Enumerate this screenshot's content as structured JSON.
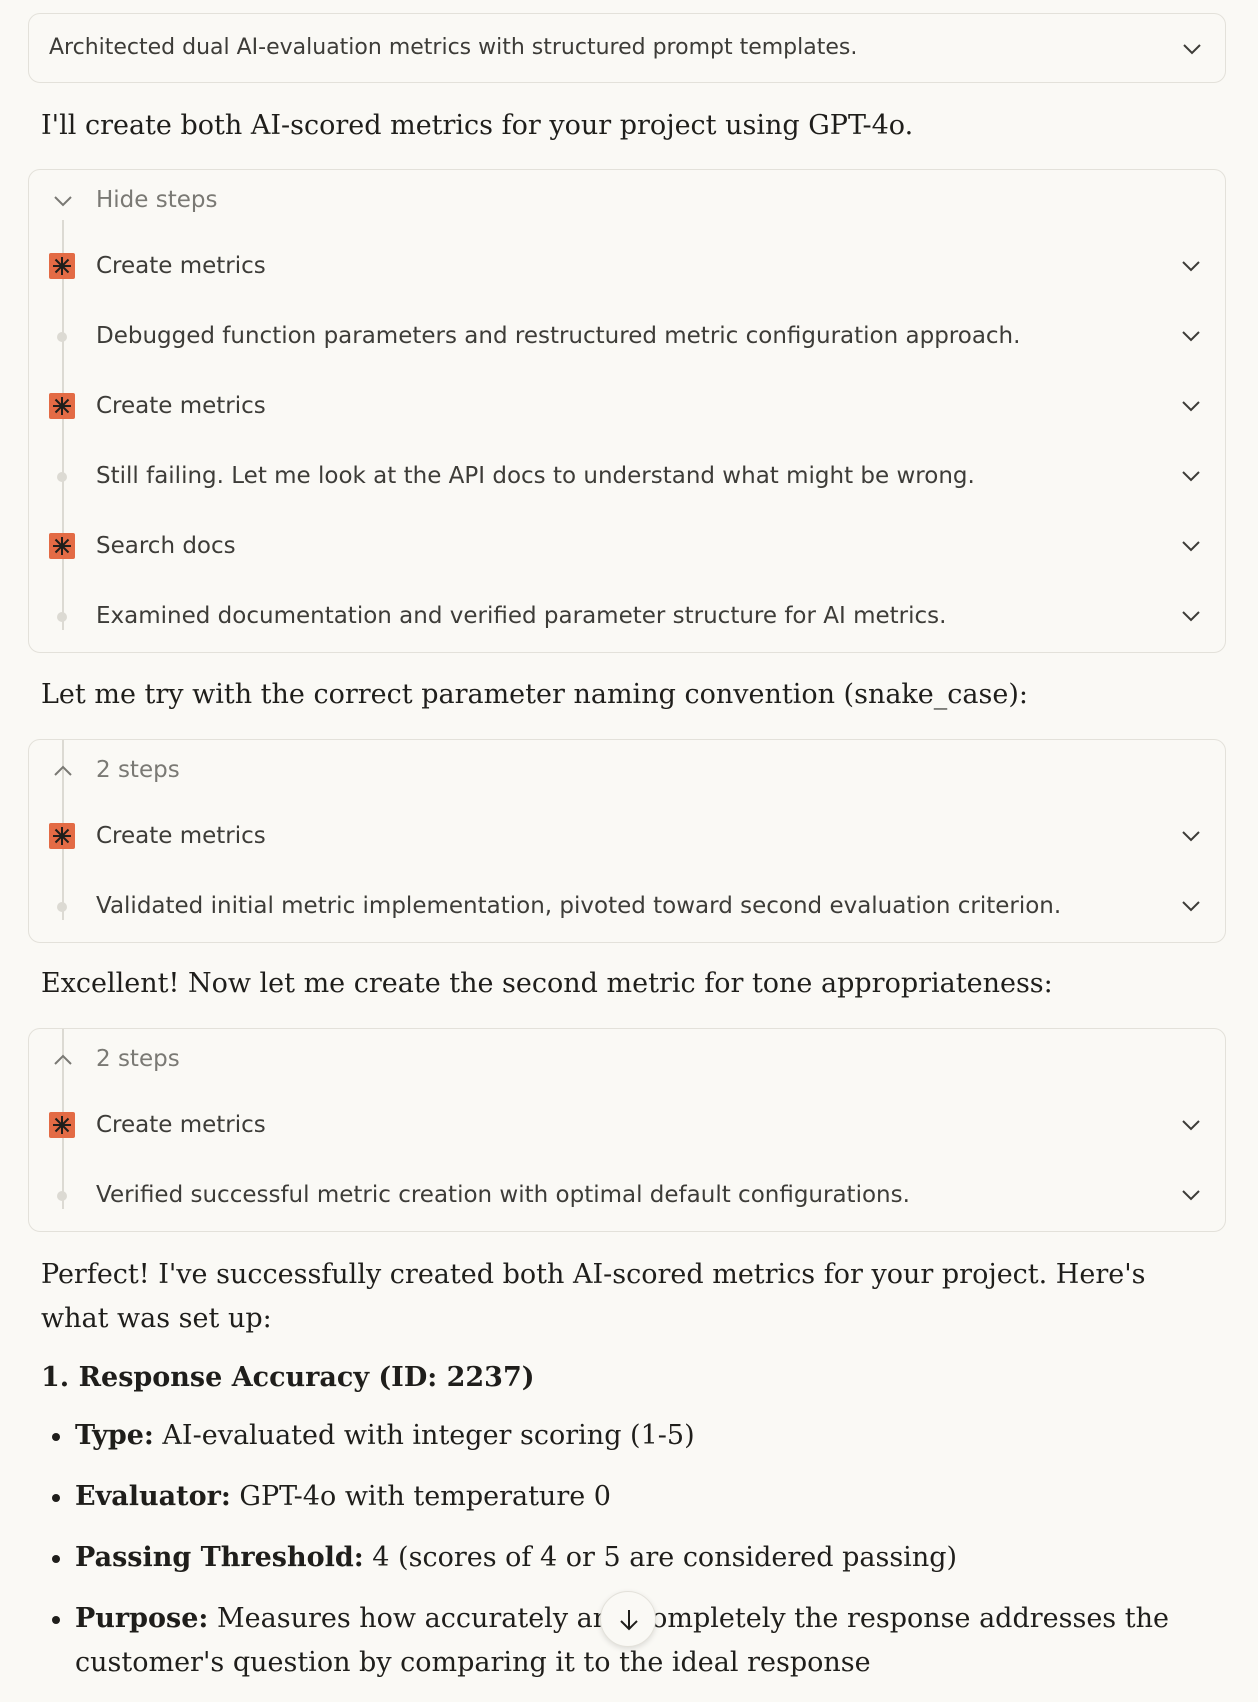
{
  "thought_summary": "Architected dual AI-evaluation metrics with structured prompt templates.",
  "intro": "I'll create both AI-scored metrics for your project using GPT-4o.",
  "panel1": {
    "toggle_label": "Hide steps",
    "steps": [
      {
        "kind": "tool",
        "label": "Create metrics"
      },
      {
        "kind": "thought",
        "label": "Debugged function parameters and restructured metric configuration approach."
      },
      {
        "kind": "tool",
        "label": "Create metrics"
      },
      {
        "kind": "thought",
        "label": "Still failing. Let me look at the API docs to understand what might be wrong."
      },
      {
        "kind": "tool",
        "label": "Search docs"
      },
      {
        "kind": "thought",
        "label": "Examined documentation and verified parameter structure for AI metrics."
      }
    ]
  },
  "msg2": "Let me try with the correct parameter naming convention (snake_case):",
  "panel2": {
    "toggle_label": "2 steps",
    "steps": [
      {
        "kind": "tool",
        "label": "Create metrics"
      },
      {
        "kind": "thought",
        "label": "Validated initial metric implementation, pivoted toward second evaluation criterion."
      }
    ]
  },
  "msg3": "Excellent! Now let me create the second metric for tone appropriateness:",
  "panel3": {
    "toggle_label": "2 steps",
    "steps": [
      {
        "kind": "tool",
        "label": "Create metrics"
      },
      {
        "kind": "thought",
        "label": "Verified successful metric creation with optimal default configurations."
      }
    ]
  },
  "summary_intro": "Perfect! I've successfully created both AI-scored metrics for your project. Here's what was set up:",
  "metric1": {
    "heading": "1. Response Accuracy (ID: 2237)",
    "items": [
      {
        "key": "Type:",
        "value": " AI-evaluated with integer scoring (1-5)"
      },
      {
        "key": "Evaluator:",
        "value": " GPT-4o with temperature 0"
      },
      {
        "key": "Passing Threshold:",
        "value": " 4 (scores of 4 or 5 are considered passing)"
      },
      {
        "key": "Purpose:",
        "value": " Measures how accurately and completely the response addresses the customer's question by comparing it to the ideal response"
      }
    ]
  },
  "icons": {
    "tool": "asterisk-icon",
    "chevron": "chevron-down-icon",
    "scroll": "arrow-down-icon"
  },
  "colors": {
    "accent": "#e36b45",
    "background": "#faf9f5"
  }
}
